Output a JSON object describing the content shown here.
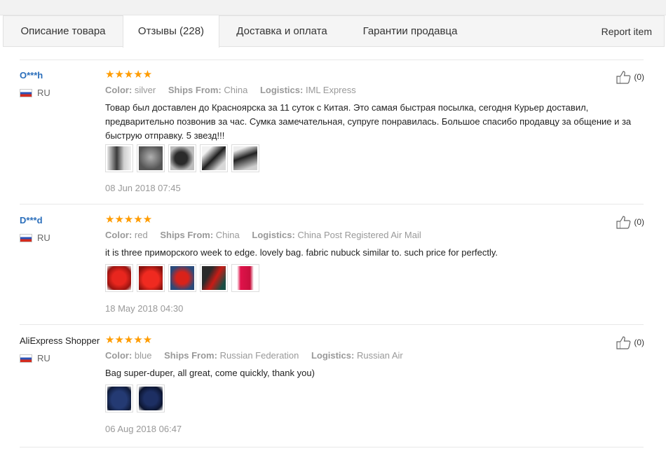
{
  "tabs": [
    {
      "label": "Описание товара"
    },
    {
      "label": "Отзывы (228)"
    },
    {
      "label": "Доставка и оплата"
    },
    {
      "label": "Гарантии продавца"
    }
  ],
  "report_label": "Report item",
  "labels": {
    "color": "Color:",
    "ships_from": "Ships From:",
    "logistics": "Logistics:"
  },
  "icons": {
    "rating": "star-icon",
    "helpful": "thumbs-up-icon",
    "country": "flag-ru-icon"
  },
  "colors": {
    "stars": "#ff9c00",
    "username": "#2a6ebb"
  },
  "reviews": [
    {
      "user": "O***h",
      "country": "RU",
      "rating": 5,
      "stars": "★★★★★",
      "color": "silver",
      "ships_from": "China",
      "logistics": "IML Express",
      "text": "Товар был доставлен до Красноярска за 11 суток с Китая. Это самая быстрая посылка, сегодня Курьер доставил, предварительно позвонив за час. Сумка замечательная, супруге понравилась. Большое спасибо продавцу за общение и за быструю отправку. 5 звезд!!!",
      "date": "08 Jun 2018 07:45",
      "helpful": "(0)",
      "photo_count": 5
    },
    {
      "user": "D***d",
      "country": "RU",
      "rating": 5,
      "stars": "★★★★★",
      "color": "red",
      "ships_from": "China",
      "logistics": "China Post Registered Air Mail",
      "text": "it is three приморского week to edge. lovely bag. fabric nubuck similar to. such price for perfectly.",
      "date": "18 May 2018 04:30",
      "helpful": "(0)",
      "photo_count": 5
    },
    {
      "user": "AliExpress Shopper",
      "country": "RU",
      "rating": 5,
      "stars": "★★★★★",
      "color": "blue",
      "ships_from": "Russian Federation",
      "logistics": "Russian Air",
      "text": "Bag super-duper, all great, come quickly, thank you)",
      "date": "06 Aug 2018 06:47",
      "helpful": "(0)",
      "photo_count": 2
    }
  ]
}
